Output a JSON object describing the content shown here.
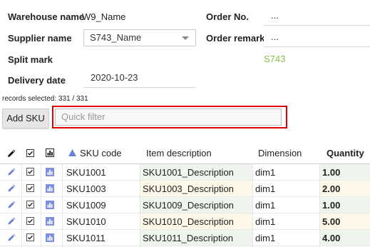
{
  "form": {
    "warehouse_label": "Warehouse name",
    "warehouse_value": "W9_Name",
    "supplier_label": "Supplier name",
    "supplier_value": "S743_Name",
    "split_label": "Split mark",
    "delivery_label": "Delivery date",
    "delivery_value": "2020-10-23",
    "order_no_label": "Order No.",
    "order_no_value": "...",
    "order_remark_label": "Order remark",
    "order_remark_value": "...",
    "supplier_code": "S743"
  },
  "records_selected": "records selected: 331 / 331",
  "toolbar": {
    "add_sku_label": "Add SKU",
    "quick_filter_placeholder": "Quick filter"
  },
  "table": {
    "headers": {
      "sku": "SKU code",
      "description": "Item description",
      "dimension": "Dimension",
      "quantity": "Quantity"
    },
    "rows": [
      {
        "sku": "SKU1001",
        "description": "SKU1001_Description",
        "dimension": "dim1",
        "quantity": "1.00"
      },
      {
        "sku": "SKU1003",
        "description": "SKU1003_Description",
        "dimension": "dim1",
        "quantity": "2.00"
      },
      {
        "sku": "SKU1009",
        "description": "SKU1009_Description",
        "dimension": "dim1",
        "quantity": "1.00"
      },
      {
        "sku": "SKU1010",
        "description": "SKU1010_Description",
        "dimension": "dim1",
        "quantity": "5.00"
      },
      {
        "sku": "SKU1011",
        "description": "SKU1011_Description",
        "dimension": "dim1",
        "quantity": "4.00"
      }
    ]
  },
  "icons": {
    "edit": "pencil-icon",
    "select": "checkbox-icon",
    "chart": "chart-icon",
    "sort": "sort-asc-icon",
    "dropdown": "chevron-down-icon"
  },
  "colors": {
    "accent_blue": "#6b7fd6",
    "highlight_red": "#e00000",
    "supplier_code_green": "#8cc04a",
    "row_tint_green": "#eef5ec",
    "row_tint_yellow": "#fdf8e8"
  }
}
